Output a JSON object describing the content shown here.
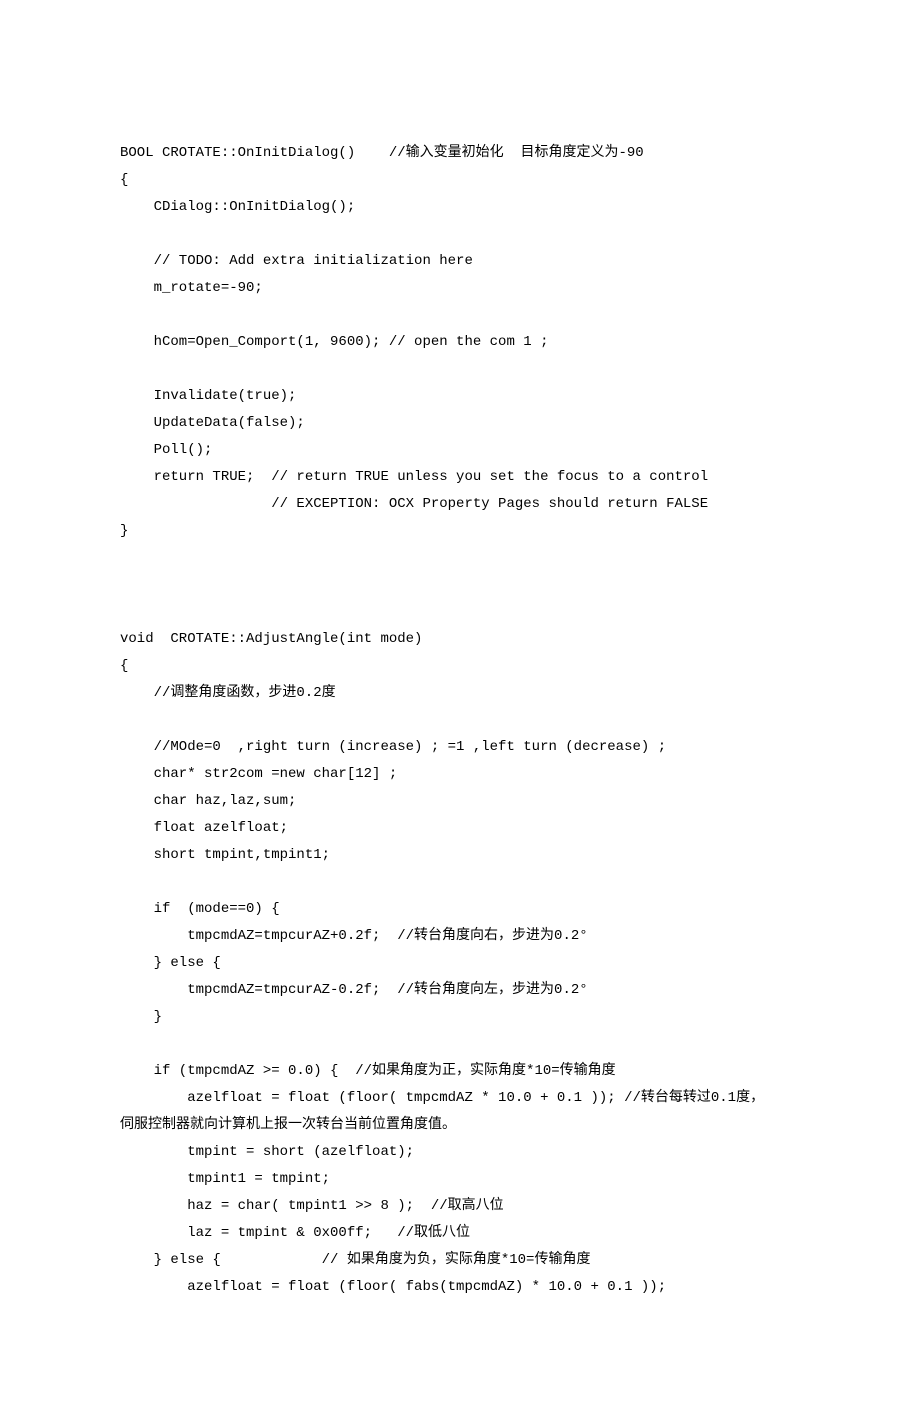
{
  "code": {
    "lines": [
      "BOOL CROTATE::OnInitDialog()    //输入变量初始化  目标角度定义为-90",
      "{",
      "    CDialog::OnInitDialog();",
      "",
      "    // TODO: Add extra initialization here",
      "    m_rotate=-90;",
      "",
      "    hCom=Open_Comport(1, 9600); // open the com 1 ;",
      "",
      "    Invalidate(true);",
      "    UpdateData(false);",
      "    Poll();",
      "    return TRUE;  // return TRUE unless you set the focus to a control",
      "                  // EXCEPTION: OCX Property Pages should return FALSE",
      "}",
      "",
      "",
      "",
      "void  CROTATE::AdjustAngle(int mode)",
      "{",
      "    //调整角度函数，步进0.2度",
      "",
      "    //MOde=0  ,right turn (increase) ; =1 ,left turn (decrease) ;",
      "    char* str2com =new char[12] ;",
      "    char haz,laz,sum;",
      "    float azelfloat;",
      "    short tmpint,tmpint1;",
      "",
      "    if  (mode==0) {",
      "        tmpcmdAZ=tmpcurAZ+0.2f;  //转台角度向右，步进为0.2°",
      "    } else {",
      "        tmpcmdAZ=tmpcurAZ-0.2f;  //转台角度向左，步进为0.2°",
      "    }",
      "",
      "    if (tmpcmdAZ >= 0.0) {  //如果角度为正，实际角度*10=传输角度",
      "        azelfloat = float (floor( tmpcmdAZ * 10.0 + 0.1 )); //转台每转过0.1度，",
      "伺服控制器就向计算机上报一次转台当前位置角度值。",
      "        tmpint = short (azelfloat);",
      "        tmpint1 = tmpint;",
      "        haz = char( tmpint1 >> 8 );  //取高八位",
      "        laz = tmpint & 0x00ff;   //取低八位",
      "    } else {            // 如果角度为负，实际角度*10=传输角度",
      "        azelfloat = float (floor( fabs(tmpcmdAZ) * 10.0 + 0.1 ));"
    ]
  }
}
